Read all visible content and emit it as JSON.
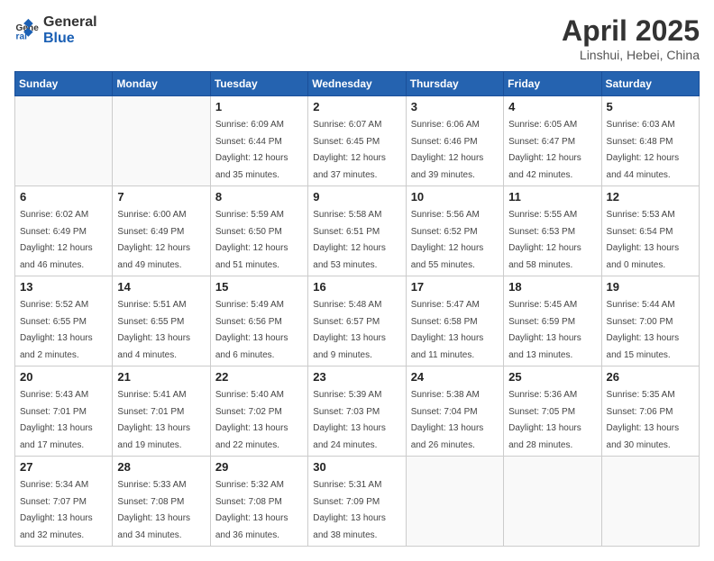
{
  "header": {
    "logo_general": "General",
    "logo_blue": "Blue",
    "title": "April 2025",
    "subtitle": "Linshui, Hebei, China"
  },
  "weekdays": [
    "Sunday",
    "Monday",
    "Tuesday",
    "Wednesday",
    "Thursday",
    "Friday",
    "Saturday"
  ],
  "weeks": [
    [
      {
        "day": "",
        "sunrise": "",
        "sunset": "",
        "daylight": ""
      },
      {
        "day": "",
        "sunrise": "",
        "sunset": "",
        "daylight": ""
      },
      {
        "day": "1",
        "sunrise": "Sunrise: 6:09 AM",
        "sunset": "Sunset: 6:44 PM",
        "daylight": "Daylight: 12 hours and 35 minutes."
      },
      {
        "day": "2",
        "sunrise": "Sunrise: 6:07 AM",
        "sunset": "Sunset: 6:45 PM",
        "daylight": "Daylight: 12 hours and 37 minutes."
      },
      {
        "day": "3",
        "sunrise": "Sunrise: 6:06 AM",
        "sunset": "Sunset: 6:46 PM",
        "daylight": "Daylight: 12 hours and 39 minutes."
      },
      {
        "day": "4",
        "sunrise": "Sunrise: 6:05 AM",
        "sunset": "Sunset: 6:47 PM",
        "daylight": "Daylight: 12 hours and 42 minutes."
      },
      {
        "day": "5",
        "sunrise": "Sunrise: 6:03 AM",
        "sunset": "Sunset: 6:48 PM",
        "daylight": "Daylight: 12 hours and 44 minutes."
      }
    ],
    [
      {
        "day": "6",
        "sunrise": "Sunrise: 6:02 AM",
        "sunset": "Sunset: 6:49 PM",
        "daylight": "Daylight: 12 hours and 46 minutes."
      },
      {
        "day": "7",
        "sunrise": "Sunrise: 6:00 AM",
        "sunset": "Sunset: 6:49 PM",
        "daylight": "Daylight: 12 hours and 49 minutes."
      },
      {
        "day": "8",
        "sunrise": "Sunrise: 5:59 AM",
        "sunset": "Sunset: 6:50 PM",
        "daylight": "Daylight: 12 hours and 51 minutes."
      },
      {
        "day": "9",
        "sunrise": "Sunrise: 5:58 AM",
        "sunset": "Sunset: 6:51 PM",
        "daylight": "Daylight: 12 hours and 53 minutes."
      },
      {
        "day": "10",
        "sunrise": "Sunrise: 5:56 AM",
        "sunset": "Sunset: 6:52 PM",
        "daylight": "Daylight: 12 hours and 55 minutes."
      },
      {
        "day": "11",
        "sunrise": "Sunrise: 5:55 AM",
        "sunset": "Sunset: 6:53 PM",
        "daylight": "Daylight: 12 hours and 58 minutes."
      },
      {
        "day": "12",
        "sunrise": "Sunrise: 5:53 AM",
        "sunset": "Sunset: 6:54 PM",
        "daylight": "Daylight: 13 hours and 0 minutes."
      }
    ],
    [
      {
        "day": "13",
        "sunrise": "Sunrise: 5:52 AM",
        "sunset": "Sunset: 6:55 PM",
        "daylight": "Daylight: 13 hours and 2 minutes."
      },
      {
        "day": "14",
        "sunrise": "Sunrise: 5:51 AM",
        "sunset": "Sunset: 6:55 PM",
        "daylight": "Daylight: 13 hours and 4 minutes."
      },
      {
        "day": "15",
        "sunrise": "Sunrise: 5:49 AM",
        "sunset": "Sunset: 6:56 PM",
        "daylight": "Daylight: 13 hours and 6 minutes."
      },
      {
        "day": "16",
        "sunrise": "Sunrise: 5:48 AM",
        "sunset": "Sunset: 6:57 PM",
        "daylight": "Daylight: 13 hours and 9 minutes."
      },
      {
        "day": "17",
        "sunrise": "Sunrise: 5:47 AM",
        "sunset": "Sunset: 6:58 PM",
        "daylight": "Daylight: 13 hours and 11 minutes."
      },
      {
        "day": "18",
        "sunrise": "Sunrise: 5:45 AM",
        "sunset": "Sunset: 6:59 PM",
        "daylight": "Daylight: 13 hours and 13 minutes."
      },
      {
        "day": "19",
        "sunrise": "Sunrise: 5:44 AM",
        "sunset": "Sunset: 7:00 PM",
        "daylight": "Daylight: 13 hours and 15 minutes."
      }
    ],
    [
      {
        "day": "20",
        "sunrise": "Sunrise: 5:43 AM",
        "sunset": "Sunset: 7:01 PM",
        "daylight": "Daylight: 13 hours and 17 minutes."
      },
      {
        "day": "21",
        "sunrise": "Sunrise: 5:41 AM",
        "sunset": "Sunset: 7:01 PM",
        "daylight": "Daylight: 13 hours and 19 minutes."
      },
      {
        "day": "22",
        "sunrise": "Sunrise: 5:40 AM",
        "sunset": "Sunset: 7:02 PM",
        "daylight": "Daylight: 13 hours and 22 minutes."
      },
      {
        "day": "23",
        "sunrise": "Sunrise: 5:39 AM",
        "sunset": "Sunset: 7:03 PM",
        "daylight": "Daylight: 13 hours and 24 minutes."
      },
      {
        "day": "24",
        "sunrise": "Sunrise: 5:38 AM",
        "sunset": "Sunset: 7:04 PM",
        "daylight": "Daylight: 13 hours and 26 minutes."
      },
      {
        "day": "25",
        "sunrise": "Sunrise: 5:36 AM",
        "sunset": "Sunset: 7:05 PM",
        "daylight": "Daylight: 13 hours and 28 minutes."
      },
      {
        "day": "26",
        "sunrise": "Sunrise: 5:35 AM",
        "sunset": "Sunset: 7:06 PM",
        "daylight": "Daylight: 13 hours and 30 minutes."
      }
    ],
    [
      {
        "day": "27",
        "sunrise": "Sunrise: 5:34 AM",
        "sunset": "Sunset: 7:07 PM",
        "daylight": "Daylight: 13 hours and 32 minutes."
      },
      {
        "day": "28",
        "sunrise": "Sunrise: 5:33 AM",
        "sunset": "Sunset: 7:08 PM",
        "daylight": "Daylight: 13 hours and 34 minutes."
      },
      {
        "day": "29",
        "sunrise": "Sunrise: 5:32 AM",
        "sunset": "Sunset: 7:08 PM",
        "daylight": "Daylight: 13 hours and 36 minutes."
      },
      {
        "day": "30",
        "sunrise": "Sunrise: 5:31 AM",
        "sunset": "Sunset: 7:09 PM",
        "daylight": "Daylight: 13 hours and 38 minutes."
      },
      {
        "day": "",
        "sunrise": "",
        "sunset": "",
        "daylight": ""
      },
      {
        "day": "",
        "sunrise": "",
        "sunset": "",
        "daylight": ""
      },
      {
        "day": "",
        "sunrise": "",
        "sunset": "",
        "daylight": ""
      }
    ]
  ]
}
